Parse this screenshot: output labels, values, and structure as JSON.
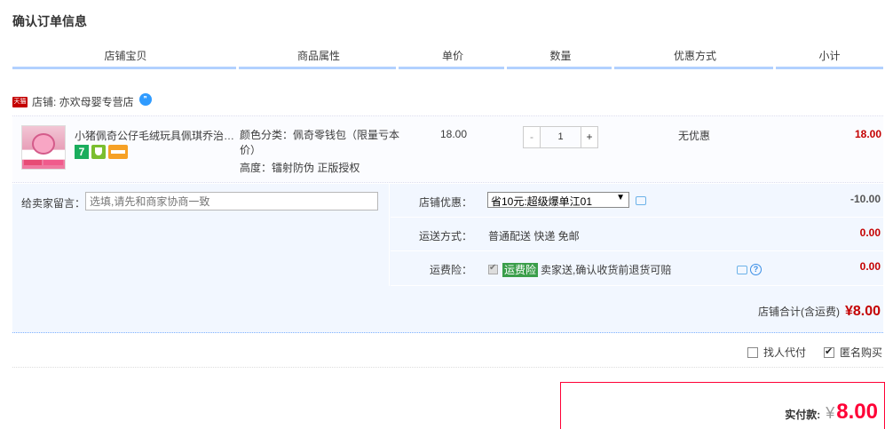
{
  "page": {
    "title": "确认订单信息"
  },
  "columns": [
    "店铺宝贝",
    "商品属性",
    "单价",
    "数量",
    "优惠方式",
    "小计"
  ],
  "shop": {
    "badge": "天猫",
    "label": "店铺: 亦欢母婴专营店"
  },
  "item": {
    "name": "小猪佩奇公仔毛绒玩具佩琪乔治…",
    "attr_color": "颜色分类：佩奇零钱包（限量亏本价）",
    "attr_height": "高度：镭射防伪 正版授权",
    "price": "18.00",
    "quantity": "1",
    "minus": "-",
    "plus": "+",
    "promotion": "无优惠",
    "subtotal": "18.00"
  },
  "memo": {
    "label": "给卖家留言：",
    "placeholder": "选填,请先和商家协商一致"
  },
  "coupon": {
    "label": "店铺优惠：",
    "selected": "省10元:超级爆单江01",
    "amount": "-10.00"
  },
  "shipping": {
    "label": "运送方式：",
    "value": "普通配送 快递 免邮",
    "amount": "0.00"
  },
  "insurance": {
    "label": "运费险：",
    "tag": "运费险",
    "text": "卖家送,确认收货前退货可赔",
    "amount": "0.00"
  },
  "shop_total": {
    "label": "店铺合计(含运费)",
    "value": "¥8.00"
  },
  "options": {
    "proxy_pay": "找人代付",
    "anonymous": "匿名购买"
  },
  "payment": {
    "label": "实付款:",
    "currency": "¥",
    "value": "8.00"
  },
  "colors": {
    "price_red": "#c40000",
    "pay_red": "#ff0036",
    "header_border": "#b2d1ff",
    "panel_bg": "#f2f7ff"
  }
}
